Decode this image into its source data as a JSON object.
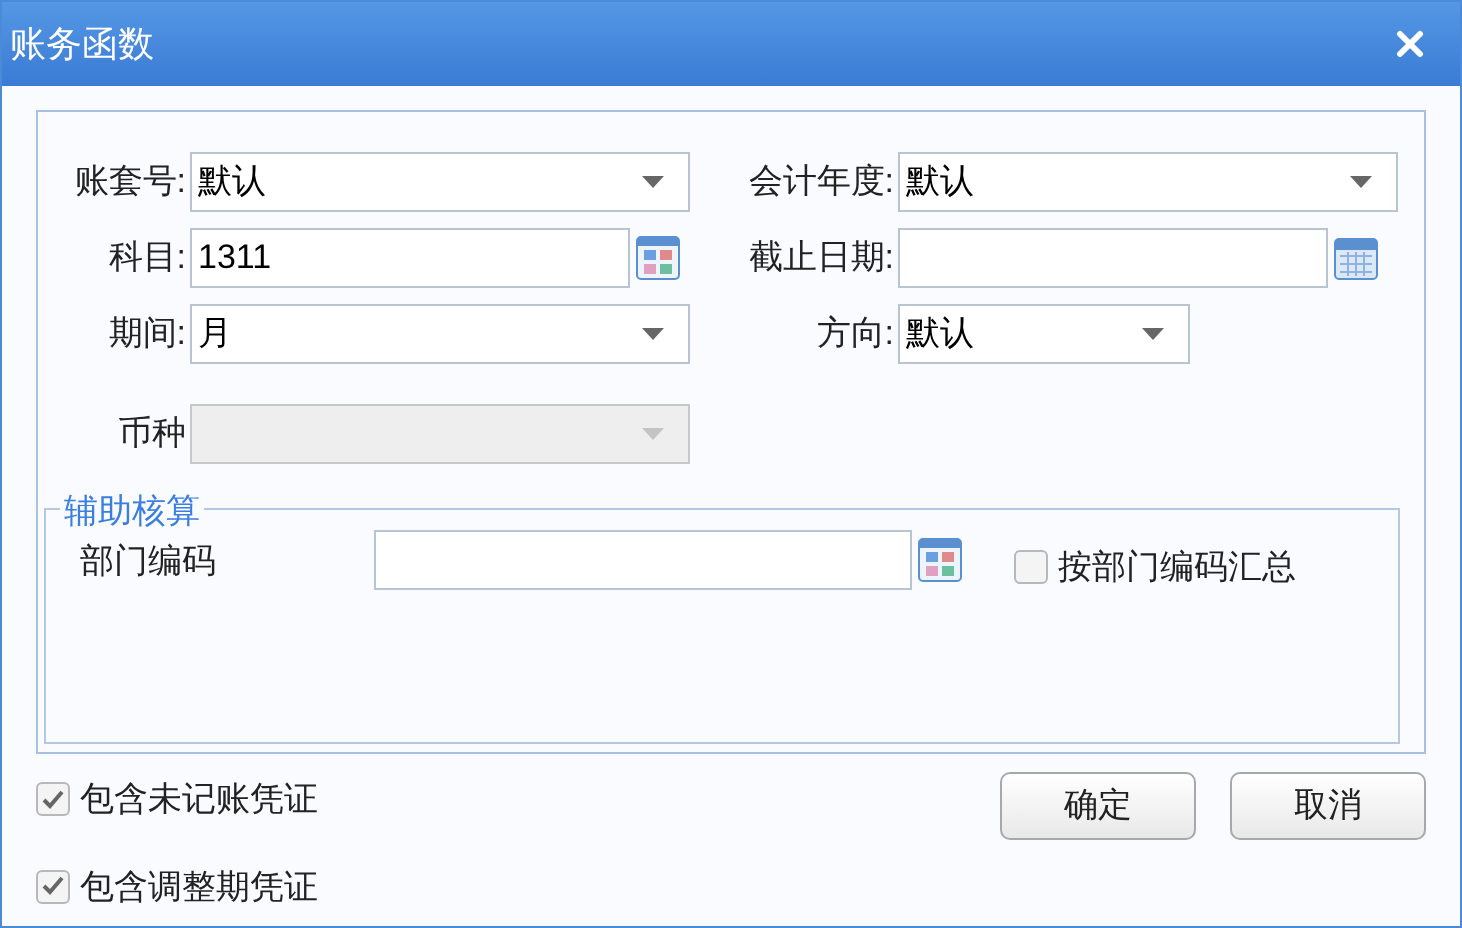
{
  "window": {
    "title": "账务函数"
  },
  "rows": [
    [
      {
        "label": "账套号:",
        "kind": "dropdown",
        "value": "默认",
        "disabled": false
      },
      {
        "label": "会计年度:",
        "kind": "dropdown",
        "value": "默认",
        "disabled": false
      }
    ],
    [
      {
        "label": "科目:",
        "kind": "lookup",
        "value": "1311",
        "disabled": false
      },
      {
        "label": "截止日期:",
        "kind": "date",
        "disabled": false
      }
    ],
    [
      {
        "label": "期间:",
        "kind": "dropdown",
        "value": "月",
        "disabled": false
      },
      {
        "label": "方向:",
        "kind": "dropdown",
        "value": "默认",
        "disabled": false
      }
    ],
    [
      {
        "label": "币种",
        "kind": "dropdown",
        "disabled": true
      }
    ]
  ],
  "auxiliary": {
    "legend": "辅助核算",
    "field": {
      "label": "部门编码",
      "kind": "lookup"
    },
    "checkbox": {
      "label": "按部门编码汇总",
      "checked": false
    }
  },
  "options": [
    {
      "label": "包含未记账凭证",
      "checked": true
    },
    {
      "label": "包含调整期凭证",
      "checked": true
    }
  ],
  "buttons": [
    "确定",
    "取消"
  ]
}
